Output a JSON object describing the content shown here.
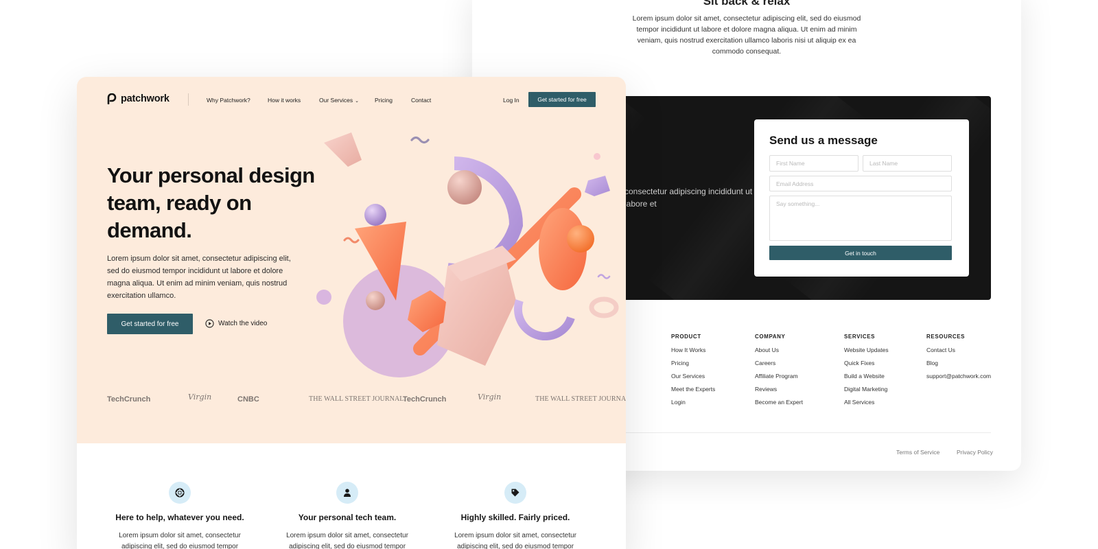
{
  "back_page": {
    "heading": "Sit back & relax",
    "paragraph": "Lorem ipsum dolor sit amet, consectetur adipiscing elit, sed do eiusmod tempor incididunt ut labore et dolore magna aliqua. Ut enim ad minim veniam, quis nostrud exercitation ullamco laboris nisi ut aliquip ex ea commodo consequat.",
    "dark_text": "consectetur adipiscing incididunt ut labore et",
    "form": {
      "title": "Send us a message",
      "first_name_placeholder": "First Name",
      "last_name_placeholder": "Last Name",
      "email_placeholder": "Email Address",
      "message_placeholder": "Say something...",
      "submit_label": "Get in touch"
    },
    "footer": {
      "columns": [
        {
          "heading": "PRODUCT",
          "links": [
            "How It Works",
            "Pricing",
            "Our Services",
            "Meet the Experts",
            "Login"
          ]
        },
        {
          "heading": "COMPANY",
          "links": [
            "About Us",
            "Careers",
            "Affiliate Program",
            "Reviews",
            "Become an Expert"
          ]
        },
        {
          "heading": "SERVICES",
          "links": [
            "Website Updates",
            "Quick Fixes",
            "Build a Website",
            "Digital Marketing",
            "All Services"
          ]
        },
        {
          "heading": "RESOURCES",
          "links": [
            "Contact Us",
            "Blog",
            "support@patchwork.com"
          ]
        }
      ],
      "terms": "Terms of Service",
      "privacy": "Privacy Policy"
    }
  },
  "front_page": {
    "logo_text": "patchwork",
    "nav": {
      "why": "Why Patchwork?",
      "how": "How it works",
      "services": "Our Services",
      "pricing": "Pricing",
      "contact": "Contact",
      "login": "Log In",
      "cta": "Get started for free"
    },
    "hero": {
      "title": "Your personal design team, ready on demand.",
      "body": "Lorem ipsum dolor sit amet, consectetur adipiscing elit, sed do eiusmod tempor incididunt ut labore et dolore magna aliqua. Ut enim ad minim veniam, quis nostrud exercitation ullamco.",
      "cta": "Get started for free",
      "video": "Watch the video"
    },
    "press": [
      "TechCrunch",
      "Virgin",
      "CNBC",
      "THE WALL STREET JOURNAL.",
      "TechCrunch",
      "Virgin",
      "THE WALL STREET JOURNAL."
    ],
    "features": [
      {
        "icon": "lifebuoy-icon",
        "title": "Here to help, whatever you need.",
        "body": "Lorem ipsum dolor sit amet, consectetur adipiscing elit, sed do eiusmod tempor"
      },
      {
        "icon": "person-icon",
        "title": "Your personal tech team.",
        "body": "Lorem ipsum dolor sit amet, consectetur adipiscing elit, sed do eiusmod tempor"
      },
      {
        "icon": "price-tag-icon",
        "title": "Highly skilled. Fairly priced.",
        "body": "Lorem ipsum dolor sit amet, consectetur adipiscing elit, sed do eiusmod tempor"
      }
    ]
  },
  "colors": {
    "accent": "#2f5d68",
    "hero_background": "#fdebdc",
    "dark_band": "#151515",
    "feature_icon_bg": "#d6ecf7"
  }
}
